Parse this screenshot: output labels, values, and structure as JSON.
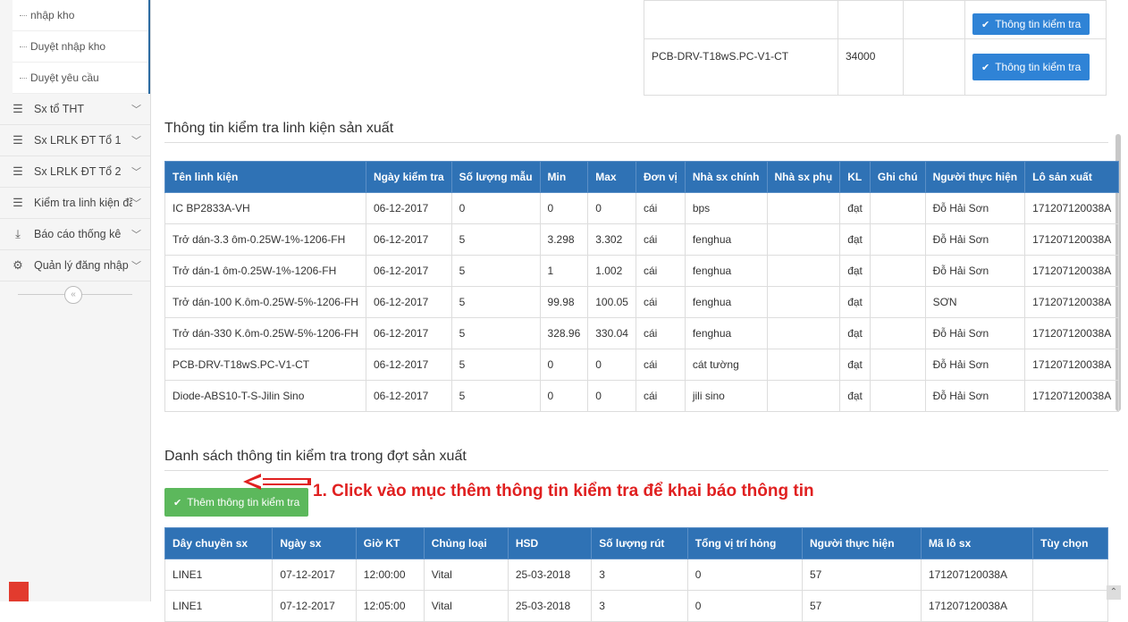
{
  "sidebar": {
    "sub_items": [
      "nhập kho",
      "Duyệt nhập kho",
      "Duyệt yêu cầu"
    ],
    "items": [
      {
        "label": "Sx tổ THT",
        "icon": "list-icon"
      },
      {
        "label": "Sx LRLK ĐT Tổ 1",
        "icon": "list-icon"
      },
      {
        "label": "Sx LRLK ĐT Tổ 2",
        "icon": "list-icon"
      },
      {
        "label": "Kiểm tra linh kiện đầu vào",
        "icon": "list-icon"
      },
      {
        "label": "Báo cáo thống kê",
        "icon": "download-icon"
      },
      {
        "label": "Quản lý đăng nhập",
        "icon": "gear-icon"
      }
    ],
    "collapse_symbol": "«"
  },
  "top_table": {
    "rows": [
      {
        "name": "",
        "qty": "",
        "extra": "",
        "button": "Thông tin kiểm tra"
      },
      {
        "name": "PCB-DRV-T18wS.PC-V1-CT",
        "qty": "34000",
        "extra": "",
        "button": "Thông tin kiểm tra"
      }
    ]
  },
  "section1": {
    "title": "Thông tin kiểm tra linh kiện sản xuất",
    "headers": [
      "Tên linh kiện",
      "Ngày kiểm tra",
      "Số lượng mẫu",
      "Min",
      "Max",
      "Đơn vị",
      "Nhà sx chính",
      "Nhà sx phụ",
      "KL",
      "Ghi chú",
      "Người thực hiện",
      "Lô sản xuất"
    ],
    "rows": [
      [
        "IC BP2833A-VH",
        "06-12-2017",
        "0",
        "0",
        "0",
        "cái",
        "bps",
        "",
        "đạt",
        "",
        "Đỗ Hải Sơn",
        "171207120038A"
      ],
      [
        "Trở dán-3.3 ôm-0.25W-1%-1206-FH",
        "06-12-2017",
        "5",
        "3.298",
        "3.302",
        "cái",
        "fenghua",
        "",
        "đạt",
        "",
        "Đỗ Hải Sơn",
        "171207120038A"
      ],
      [
        "Trở dán-1 ôm-0.25W-1%-1206-FH",
        "06-12-2017",
        "5",
        "1",
        "1.002",
        "cái",
        "fenghua",
        "",
        "đạt",
        "",
        "Đỗ Hải Sơn",
        "171207120038A"
      ],
      [
        "Trở dán-100 K.ôm-0.25W-5%-1206-FH",
        "06-12-2017",
        "5",
        "99.98",
        "100.05",
        "cái",
        "fenghua",
        "",
        "đạt",
        "",
        "SƠN",
        "171207120038A"
      ],
      [
        "Trở dán-330 K.ôm-0.25W-5%-1206-FH",
        "06-12-2017",
        "5",
        "328.96",
        "330.04",
        "cái",
        "fenghua",
        "",
        "đạt",
        "",
        "Đỗ Hải Sơn",
        "171207120038A"
      ],
      [
        "PCB-DRV-T18wS.PC-V1-CT",
        "06-12-2017",
        "5",
        "0",
        "0",
        "cái",
        "cát tường",
        "",
        "đạt",
        "",
        "Đỗ Hải Sơn",
        "171207120038A"
      ],
      [
        "Diode-ABS10-T-S-Jilin Sino",
        "06-12-2017",
        "5",
        "0",
        "0",
        "cái",
        "jili sino",
        "",
        "đạt",
        "",
        "Đỗ Hải Sơn",
        "171207120038A"
      ]
    ]
  },
  "section2": {
    "title": "Danh sách thông tin kiểm tra trong đợt sản xuất",
    "add_button": "Thêm thông tin kiểm tra",
    "annotation": "1. Click vào mục thêm thông tin kiểm tra để khai báo thông tin",
    "headers": [
      "Dây chuyền sx",
      "Ngày sx",
      "Giờ KT",
      "Chủng loại",
      "HSD",
      "Số lượng rút",
      "Tổng vị trí hỏng",
      "Người thực hiện",
      "Mã lô sx",
      "Tùy chọn"
    ],
    "rows": [
      [
        "LINE1",
        "07-12-2017",
        "12:00:00",
        "Vital",
        "25-03-2018",
        "3",
        "0",
        "57",
        "171207120038A",
        ""
      ],
      [
        "LINE1",
        "07-12-2017",
        "12:05:00",
        "Vital",
        "25-03-2018",
        "3",
        "0",
        "57",
        "171207120038A",
        ""
      ]
    ]
  },
  "colors": {
    "header_blue": "#2f72b5",
    "button_blue": "#2f83d6",
    "button_green": "#5cb85c",
    "annotation_red": "#e02020"
  }
}
